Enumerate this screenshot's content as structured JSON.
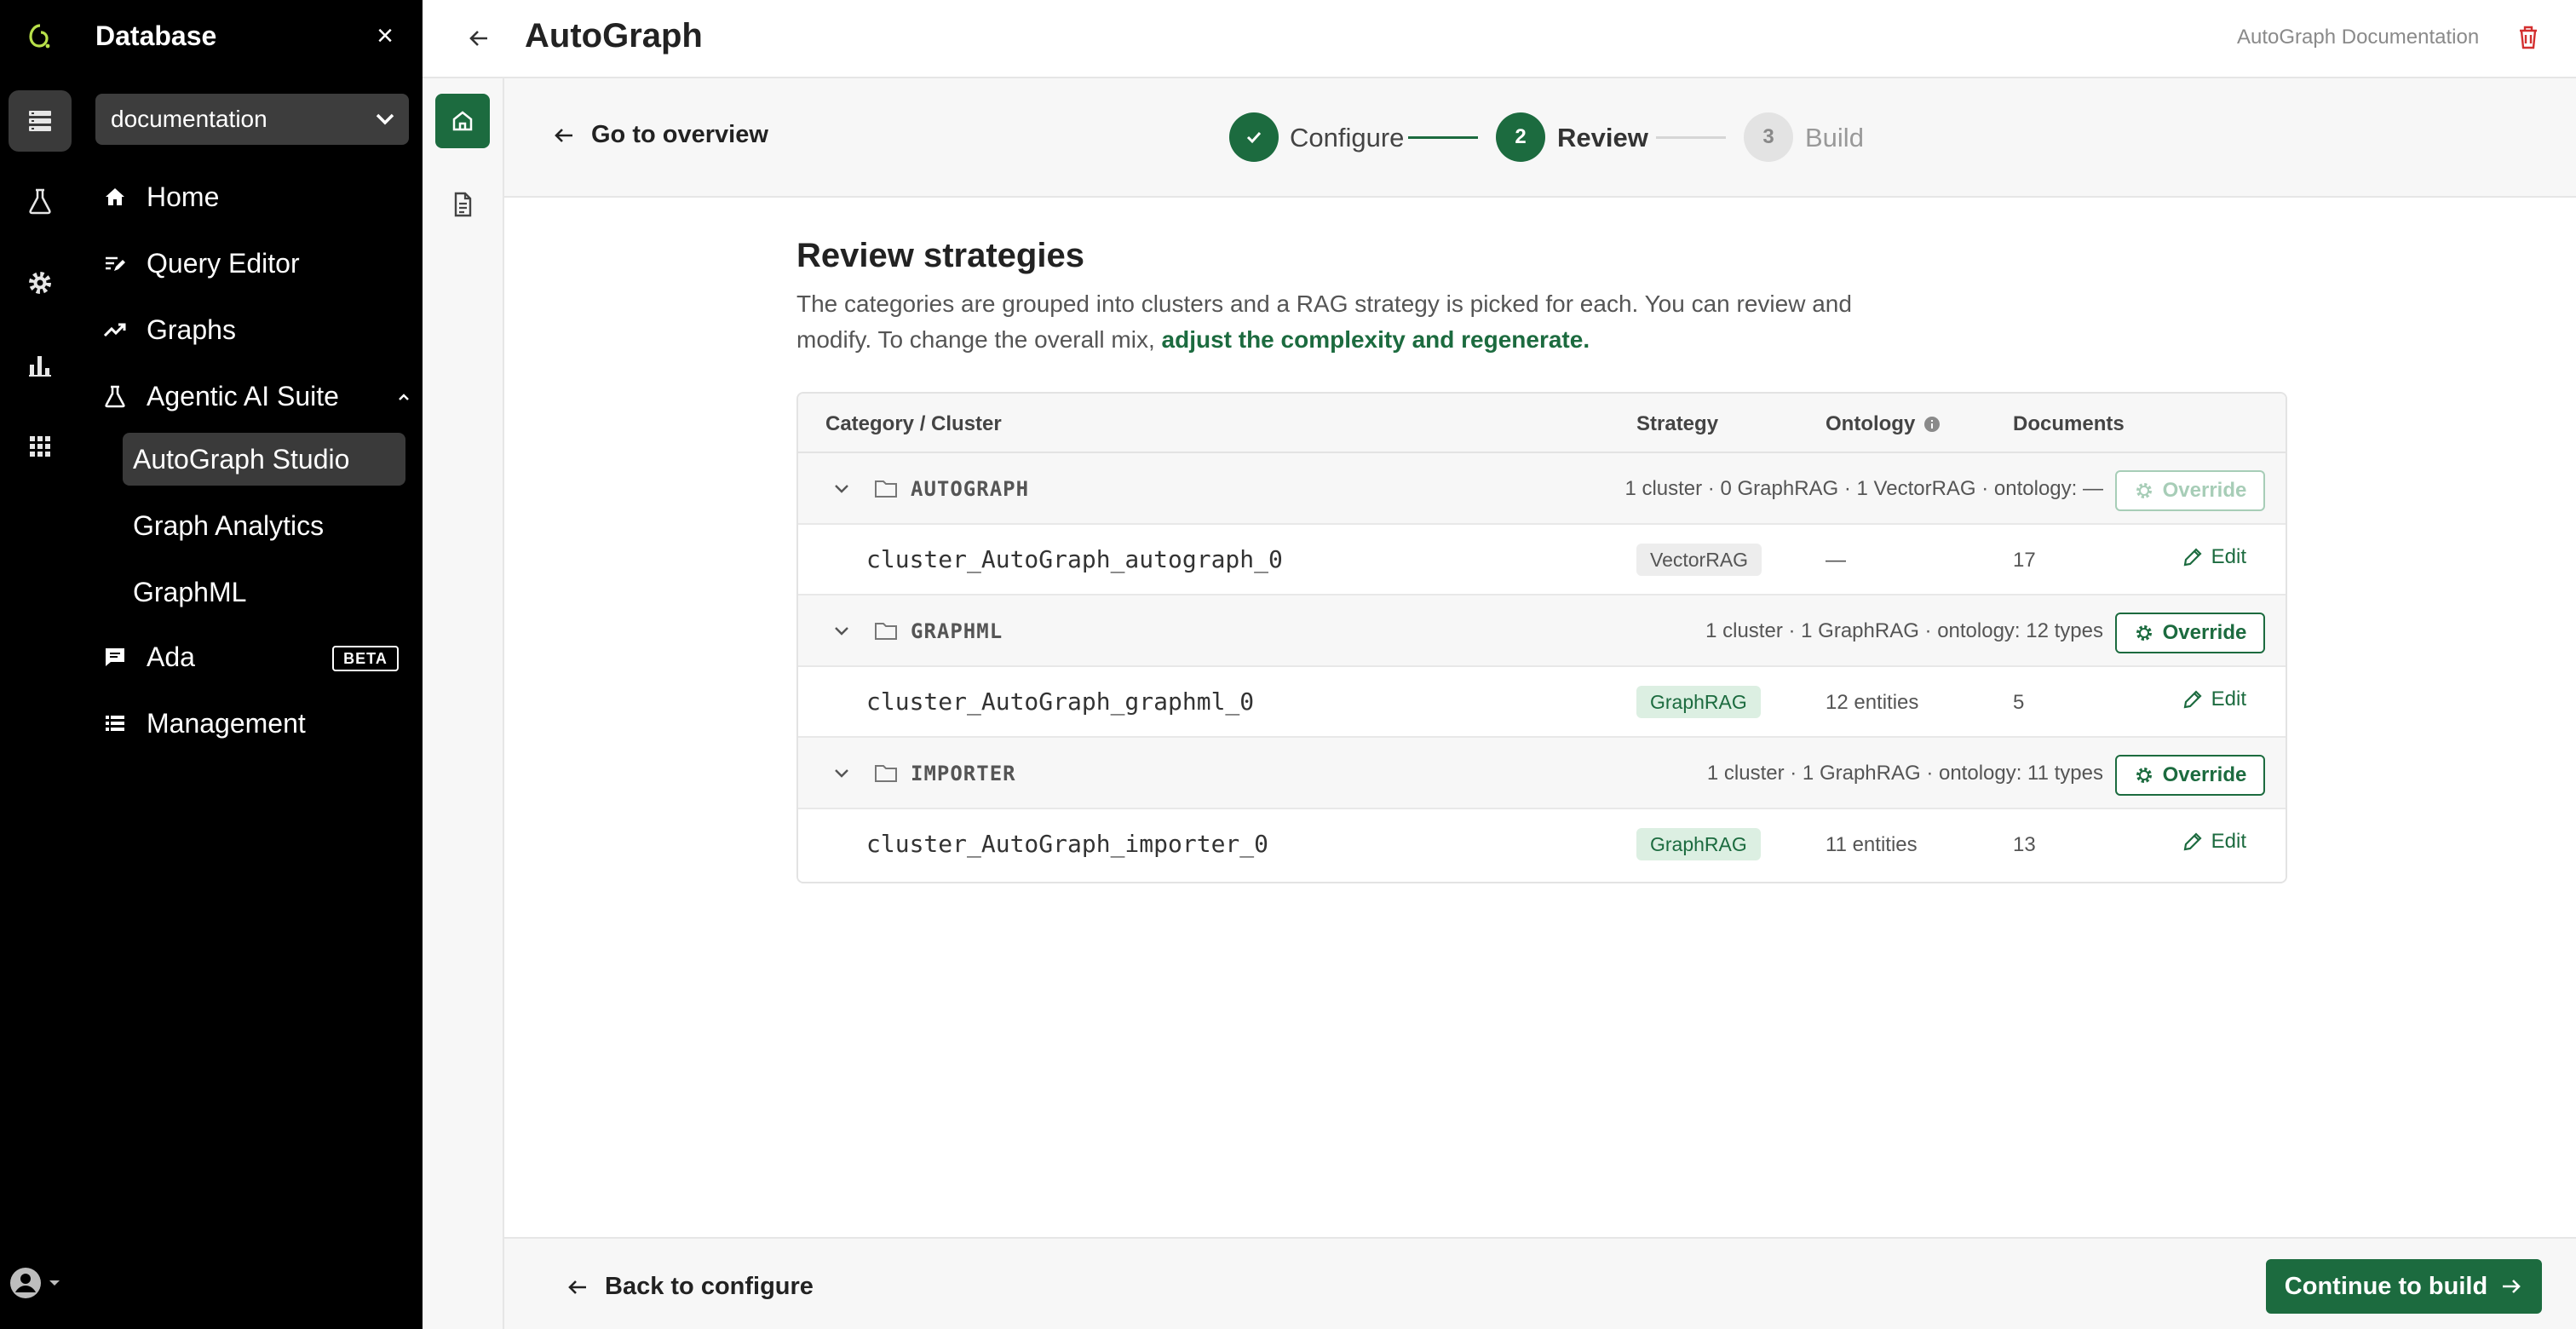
{
  "icon_rail": {
    "items": [
      {
        "icon": "app-logo-icon"
      },
      {
        "icon": "database-icon"
      },
      {
        "icon": "flask-icon"
      },
      {
        "icon": "gear-icon"
      },
      {
        "icon": "bar-chart-icon"
      },
      {
        "icon": "apps-grid-icon"
      },
      {
        "icon": "user-account-icon"
      }
    ]
  },
  "sidebar": {
    "title": "Database",
    "close_label": "×",
    "database_select": {
      "value": "documentation"
    },
    "nav": [
      {
        "label": "Home",
        "icon": "home-icon"
      },
      {
        "label": "Query Editor",
        "icon": "query-editor-icon"
      },
      {
        "label": "Graphs",
        "icon": "graphs-icon"
      },
      {
        "label": "Agentic AI Suite",
        "icon": "flask-icon",
        "expanded": true
      },
      {
        "label": "Ada",
        "icon": "chat-icon",
        "badge": "BETA"
      },
      {
        "label": "Management",
        "icon": "list-icon"
      }
    ],
    "sub_items": [
      {
        "label": "AutoGraph Studio",
        "active": true
      },
      {
        "label": "Graph Analytics",
        "active": false
      },
      {
        "label": "GraphML",
        "active": false
      }
    ]
  },
  "header": {
    "title": "AutoGraph",
    "doc_link": "AutoGraph Documentation"
  },
  "stepper": {
    "go_overview": "Go to overview",
    "steps": [
      {
        "number": "✓",
        "label": "Configure",
        "state": "done"
      },
      {
        "number": "2",
        "label": "Review",
        "state": "active"
      },
      {
        "number": "3",
        "label": "Build",
        "state": "pending"
      }
    ]
  },
  "review": {
    "title": "Review strategies",
    "description": "The categories are grouped into clusters and a RAG strategy is picked for each. You can review and modify. To change the overall mix,",
    "link_text": "adjust the complexity and regenerate."
  },
  "table": {
    "headers": {
      "category": "Category / Cluster",
      "strategy": "Strategy",
      "ontology": "Ontology",
      "documents": "Documents"
    },
    "groups": [
      {
        "name": "AUTOGRAPH",
        "summary": "1 cluster · 0 GraphRAG · 1 VectorRAG · ontology: —",
        "override_label": "Override",
        "override_enabled": false,
        "cluster": {
          "name": "cluster_AutoGraph_autograph_0",
          "strategy": "VectorRAG",
          "ontology": "—",
          "documents": "17",
          "edit_label": "Edit"
        }
      },
      {
        "name": "GRAPHML",
        "summary": "1 cluster · 1 GraphRAG · ontology: 12 types",
        "override_label": "Override",
        "override_enabled": true,
        "cluster": {
          "name": "cluster_AutoGraph_graphml_0",
          "strategy": "GraphRAG",
          "ontology": "12 entities",
          "documents": "5",
          "edit_label": "Edit"
        }
      },
      {
        "name": "IMPORTER",
        "summary": "1 cluster · 1 GraphRAG · ontology: 11 types",
        "override_label": "Override",
        "override_enabled": true,
        "cluster": {
          "name": "cluster_AutoGraph_importer_0",
          "strategy": "GraphRAG",
          "ontology": "11 entities",
          "documents": "13",
          "edit_label": "Edit"
        }
      }
    ]
  },
  "footer": {
    "back_label": "Back to configure",
    "continue_label": "Continue to build"
  },
  "colors": {
    "accent": "#1c6b3f",
    "sidebar_bg": "#000000",
    "danger": "#d32f2f"
  }
}
